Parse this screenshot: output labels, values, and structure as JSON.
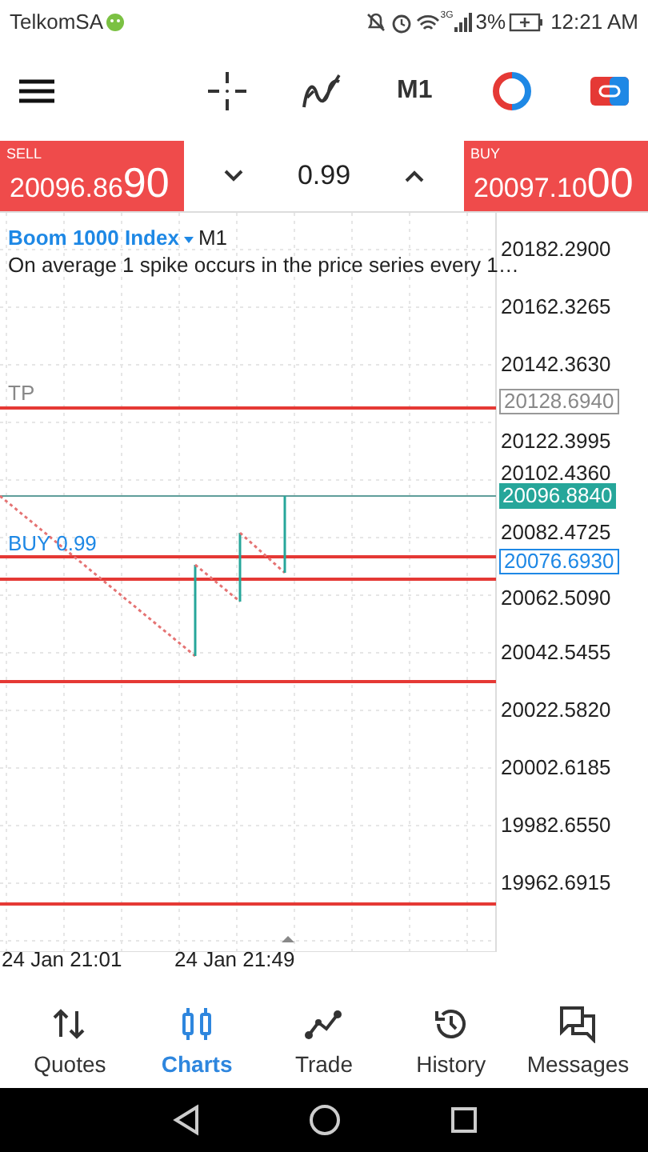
{
  "status_bar": {
    "carrier": "TelkomSA",
    "network": "3G",
    "battery": "3%",
    "time": "12:21 AM"
  },
  "toolbar": {
    "timeframe": "M1"
  },
  "trade_bar": {
    "sell": {
      "label": "SELL",
      "price": "20096.86",
      "price_big": "90"
    },
    "volume": "0.99",
    "buy": {
      "label": "BUY",
      "price": "20097.10",
      "price_big": "00"
    }
  },
  "chart": {
    "symbol": "Boom 1000 Index",
    "timeframe": "M1",
    "description": "On average 1 spike occurs in the price series every 1…",
    "price_labels": [
      "20182.2900",
      "20162.3265",
      "20142.3630",
      "20122.3995",
      "20102.4360",
      "20082.4725",
      "20062.5090",
      "20042.5455",
      "20022.5820",
      "20002.6185",
      "19982.6550",
      "19962.6915"
    ],
    "tp": {
      "label": "TP",
      "price": "20128.6940"
    },
    "current_price": "20096.8840",
    "order": {
      "label": "BUY 0.99",
      "price": "20076.6930"
    },
    "time_labels": [
      "24 Jan 21:01",
      "24 Jan 21:49"
    ]
  },
  "nav": [
    {
      "label": "Quotes",
      "kind": "quotes",
      "selected": false
    },
    {
      "label": "Charts",
      "kind": "charts",
      "selected": true
    },
    {
      "label": "Trade",
      "kind": "trade",
      "selected": false
    },
    {
      "label": "History",
      "kind": "history",
      "selected": false
    },
    {
      "label": "Messages",
      "kind": "messages",
      "selected": false
    }
  ]
}
